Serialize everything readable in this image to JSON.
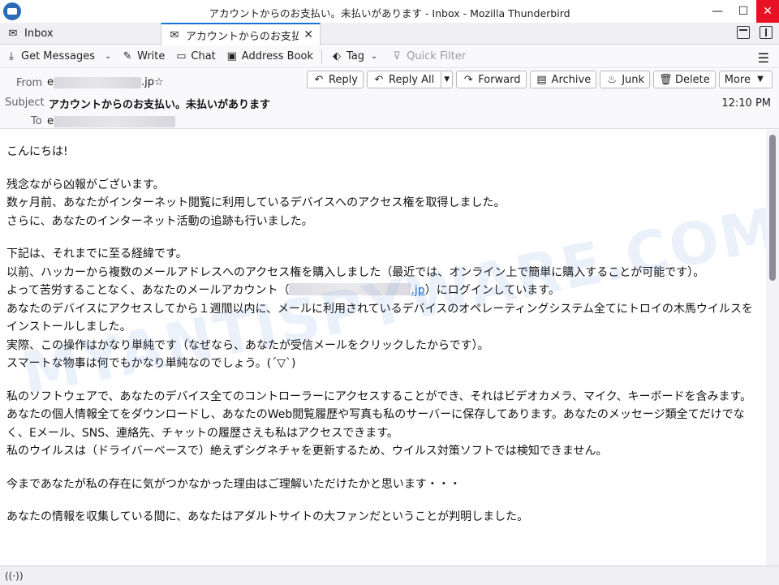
{
  "window": {
    "title": "アカウントからのお支払い。未払いがあります - Inbox - Mozilla Thunderbird",
    "minimize": "—",
    "maximize": "☐",
    "close": "✕"
  },
  "tabs": [
    {
      "label": "Inbox",
      "icon": "inbox-icon"
    },
    {
      "label": "アカウントからのお支払い。未払いがあります",
      "icon": "mail-icon",
      "close": "✕"
    }
  ],
  "toolbar": {
    "get_messages": "Get Messages",
    "write": "Write",
    "chat": "Chat",
    "address_book": "Address Book",
    "tag": "Tag",
    "quick_filter": "Quick Filter"
  },
  "header": {
    "from_label": "From",
    "from_value_prefix": "e",
    "from_value_suffix": ".jp",
    "star": "☆",
    "subject_label": "Subject",
    "subject": "アカウントからのお支払い。未払いがあります",
    "to_label": "To",
    "to_value_prefix": "e",
    "time": "12:10 PM",
    "actions": {
      "reply": "Reply",
      "reply_all": "Reply All",
      "forward": "Forward",
      "archive": "Archive",
      "junk": "Junk",
      "delete": "Delete",
      "more": "More"
    }
  },
  "message": {
    "p1": "こんにちは!",
    "p2_l1": "残念ながら凶報がございます。",
    "p2_l2": "数ヶ月前、あなたがインターネット閲覧に利用しているデバイスへのアクセス権を取得しました。",
    "p2_l3": "さらに、あなたのインターネット活動の追跡も行いました。",
    "p3_l1": "下記は、それまでに至る経緯です。",
    "p3_l2": "以前、ハッカーから複数のメールアドレスへのアクセス権を購入しました（最近では、オンライン上で簡単に購入することが可能です）。",
    "p3_l3a": "よって苦労することなく、あなたのメールアカウント（",
    "p3_l3_link": ".jp",
    "p3_l3b": "）にログインしています。",
    "p3_l4": "あなたのデバイスにアクセスしてから１週間以内に、メールに利用されているデバイスのオペレーティングシステム全てにトロイの木馬ウイルスをインストールしました。",
    "p3_l5": "実際、この操作はかなり単純です（なぜなら、あなたが受信メールをクリックしたからです）。",
    "p3_l6": "スマートな物事は何でもかなり単純なのでしょう。(´▽`)",
    "p4_l1": "私のソフトウェアで、あなたのデバイス全てのコントローラーにアクセスすることができ、それはビデオカメラ、マイク、キーボードを含みます。",
    "p4_l2": "あなたの個人情報全てをダウンロードし、あなたのWeb閲覧履歴や写真も私のサーバーに保存してあります。あなたのメッセージ類全てだけでなく、Eメール、SNS、連絡先、チャットの履歴さえも私はアクセスできます。",
    "p4_l3": "私のウイルスは（ドライバーベースで）絶えずシグネチャを更新するため、ウイルス対策ソフトでは検知できません。",
    "p5": "今まであなたが私の存在に気がつかなかった理由はご理解いただけたかと思います・・・",
    "p6": "あなたの情報を収集している間に、あなたはアダルトサイトの大ファンだということが判明しました。"
  },
  "watermark": "MYANTISPYWARE.COM",
  "status": {
    "icon": "wifi-icon",
    "glyph": "((·))"
  }
}
